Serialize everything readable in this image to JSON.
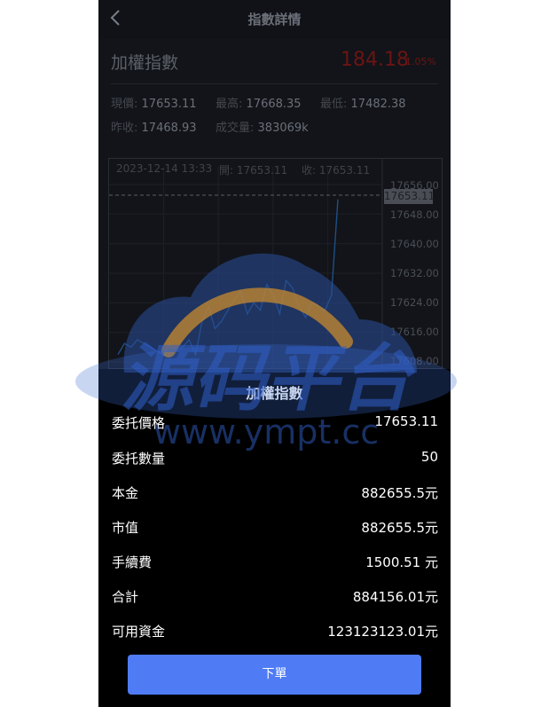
{
  "header": {
    "title": "指數詳情",
    "back_icon": "chevron-left-icon"
  },
  "quote": {
    "name": "加權指數",
    "price": "184.18",
    "change_pct": "1.05%",
    "stats": [
      {
        "label": "現價:",
        "value": "17653.11"
      },
      {
        "label": "最高:",
        "value": "17668.35"
      },
      {
        "label": "最低:",
        "value": "17482.38"
      },
      {
        "label": "昨收:",
        "value": "17468.93"
      },
      {
        "label": "成交量:",
        "value": "383069k"
      }
    ]
  },
  "chart_data": {
    "type": "line",
    "header": {
      "date": "2023-12-14 13:33",
      "open_label": "開:",
      "open": "17653.11",
      "close_label": "收:",
      "close": "17653.11"
    },
    "y_ticks": [
      "17656.00",
      "17648.00",
      "17640.00",
      "17632.00",
      "17624.00",
      "17616.00",
      "17608.00"
    ],
    "last_price_label": "17653.11",
    "ylim": [
      17608,
      17656
    ],
    "grid": true,
    "series": [
      {
        "values": [
          17610,
          17613,
          17612,
          17614,
          17613,
          17612,
          17611,
          17610,
          17613,
          17611,
          17612,
          17614,
          17610,
          17619,
          17623,
          17617,
          17619,
          17622,
          17625,
          17627,
          17621,
          17624,
          17622,
          17629,
          17626,
          17621,
          17630,
          17628,
          17623,
          17620,
          17624,
          17623,
          17622,
          17626,
          17652
        ]
      }
    ]
  },
  "order": {
    "title": "加權指數",
    "rows": [
      {
        "label": "委托價格",
        "value": "17653.11"
      },
      {
        "label": "委托數量",
        "value": "50"
      },
      {
        "label": "本金",
        "value": "882655.5元"
      },
      {
        "label": "市值",
        "value": "882655.5元"
      },
      {
        "label": "手續費",
        "value": "1500.51 元"
      },
      {
        "label": "合計",
        "value": "884156.01元"
      },
      {
        "label": "可用資金",
        "value": "123123123.01元"
      }
    ],
    "submit_label": "下單"
  },
  "watermark": {
    "brand": "源码平台",
    "url": "www.ympt.cc"
  },
  "colors": {
    "accent": "#4f7cf5",
    "down_red": "#6b1414",
    "sheet_bg": "#000000"
  }
}
